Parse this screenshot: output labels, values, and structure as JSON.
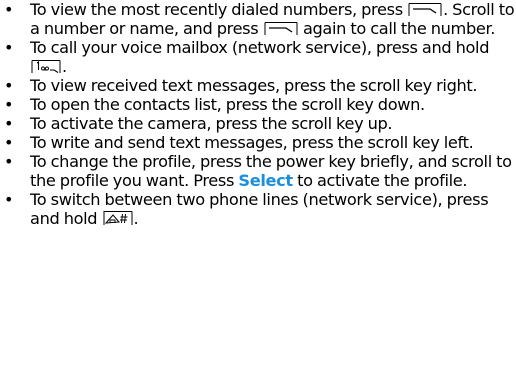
{
  "colors": {
    "highlight": "#1a8fe0",
    "text": "#000000"
  },
  "icons": {
    "call_key": "call-key-icon",
    "voicemail_key": "key-1-voicemail-icon",
    "hash_key": "hash-key-icon"
  },
  "items": [
    {
      "a": "To view the most recently dialed numbers, press",
      "b": ". Scroll to a number or name, and press",
      "c": "again to call the number."
    },
    {
      "a": "To call your voice mailbox (network service), press and hold",
      "b": "."
    },
    {
      "a": "To view received text messages, press the scroll key right."
    },
    {
      "a": "To open the contacts list, press the scroll key down."
    },
    {
      "a": "To activate the camera, press the scroll key up."
    },
    {
      "a": "To write and send text messages, press the scroll key left."
    },
    {
      "a": "To change the profile, press the power key briefly, and scroll to the profile you want. Press",
      "select": "Select",
      "b": "to activate the profile."
    },
    {
      "a": "To switch between two phone lines (network service), press and hold",
      "b": "."
    }
  ]
}
